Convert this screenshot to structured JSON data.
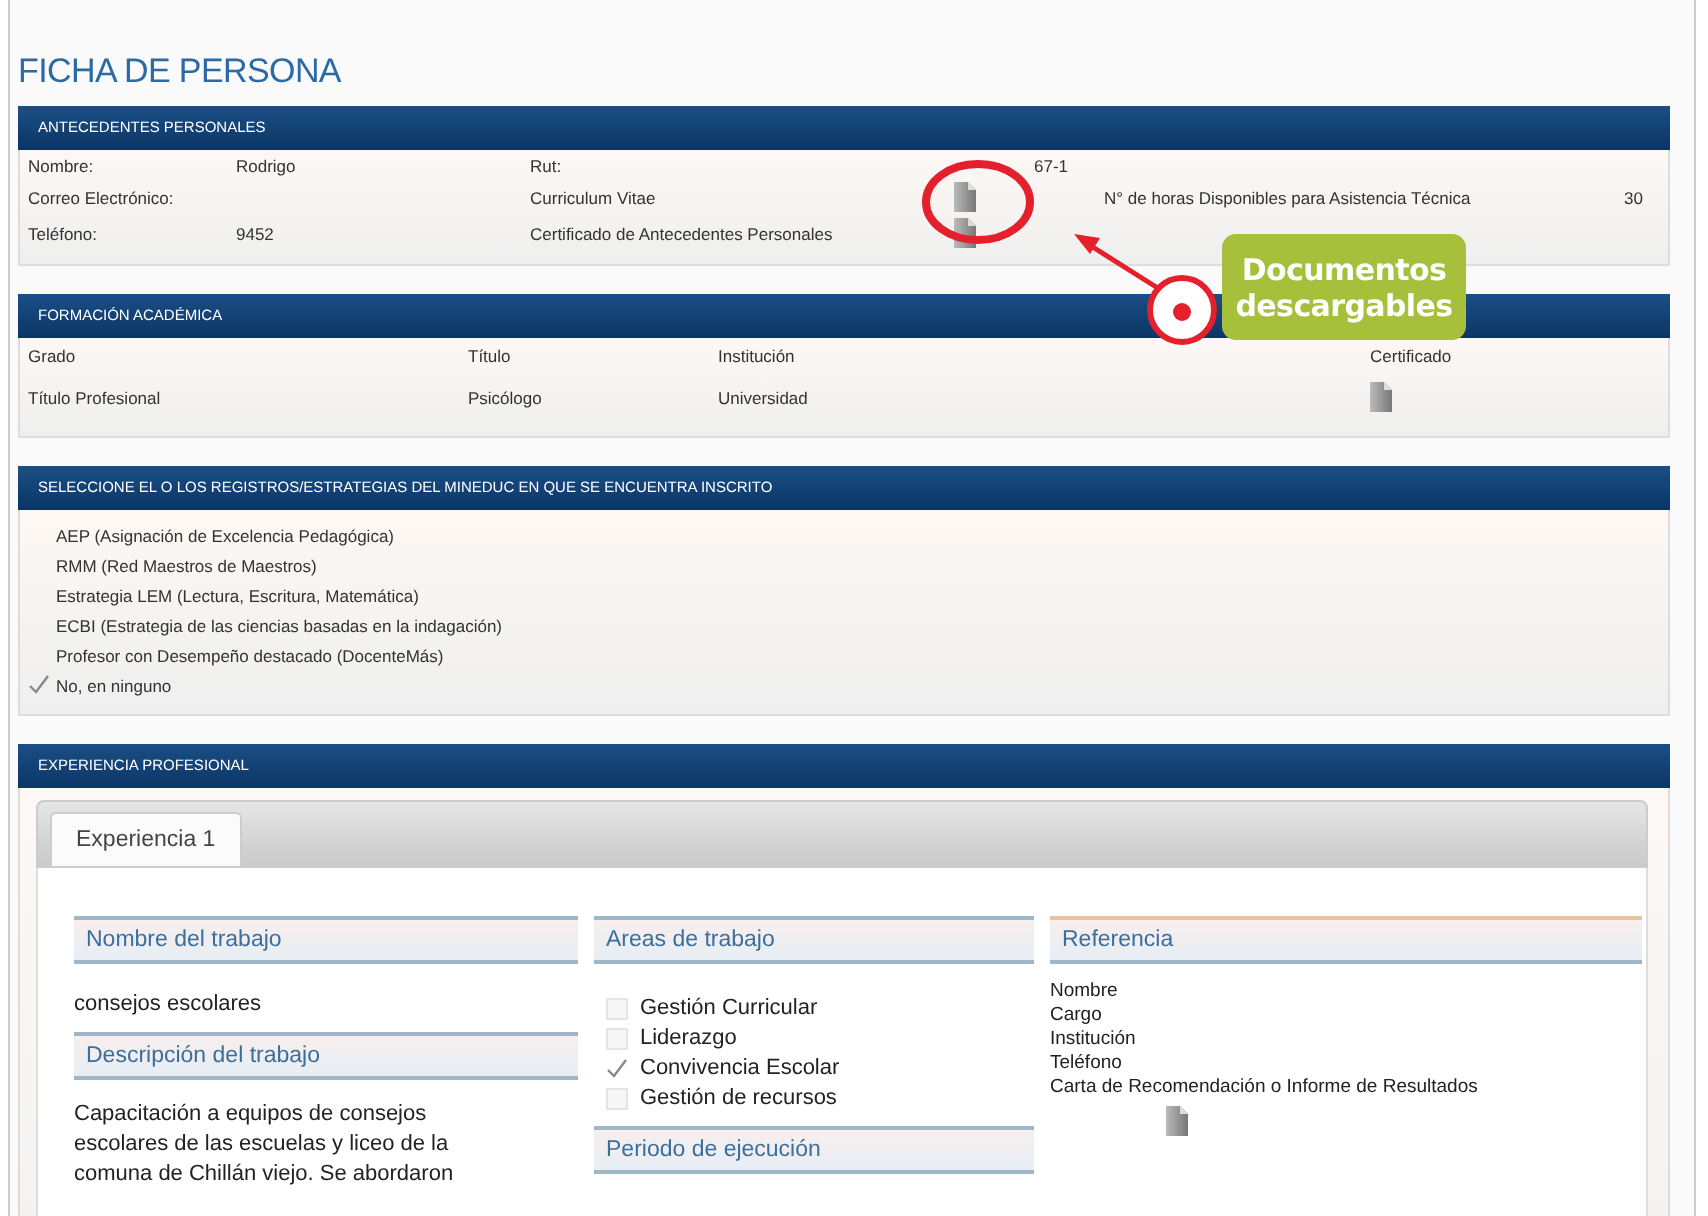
{
  "title": "FICHA DE PERSONA",
  "personal": {
    "heading": "ANTECEDENTES PERSONALES",
    "rows": [
      [
        {
          "kind": "label",
          "text": "Nombre:"
        },
        {
          "kind": "value",
          "text": "Rodrigo"
        },
        {
          "kind": "label",
          "text": "Rut:"
        },
        {
          "kind": "empty"
        },
        {
          "kind": "value",
          "text": "67-1"
        },
        {
          "kind": "empty"
        },
        {
          "kind": "empty"
        }
      ],
      [
        {
          "kind": "label",
          "text": "Correo Electrónico:"
        },
        {
          "kind": "empty"
        },
        {
          "kind": "label",
          "text": "Curriculum Vitae"
        },
        {
          "kind": "doc"
        },
        {
          "kind": "empty"
        },
        {
          "kind": "label",
          "text": "N° de horas Disponibles para Asistencia Técnica"
        },
        {
          "kind": "value",
          "text": "30"
        }
      ],
      [
        {
          "kind": "label",
          "text": "Teléfono:"
        },
        {
          "kind": "value",
          "text": "9452"
        },
        {
          "kind": "label",
          "text": "Certificado de Antecedentes Personales"
        },
        {
          "kind": "doc"
        }
      ]
    ]
  },
  "education": {
    "heading": "FORMACIÓN ACADÉMICA",
    "columns": [
      "Grado",
      "Título",
      "Institución",
      "Certificado"
    ],
    "rows": [
      [
        {
          "kind": "value",
          "text": "Título Profesional"
        },
        {
          "kind": "value",
          "text": "Psicólogo"
        },
        {
          "kind": "value",
          "text": "Universidad"
        },
        {
          "kind": "doc"
        }
      ]
    ]
  },
  "registries": {
    "heading": "SELECCIONE EL O LOS REGISTROS/ESTRATEGIAS DEL MINEDUC EN QUE SE ENCUENTRA INSCRITO",
    "items": [
      {
        "label": "AEP (Asignación de Excelencia Pedagógica)",
        "checked": false
      },
      {
        "label": "RMM (Red Maestros de Maestros)",
        "checked": false
      },
      {
        "label": "Estrategia LEM (Lectura, Escritura, Matemática)",
        "checked": false
      },
      {
        "label": "ECBI (Estrategia de las ciencias basadas en la indagación)",
        "checked": false
      },
      {
        "label": "Profesor con Desempeño destacado (DocenteMás)",
        "checked": false
      },
      {
        "label": "No, en ninguno",
        "checked": true
      }
    ]
  },
  "experience": {
    "heading": "EXPERIENCIA PROFESIONAL",
    "tabs": [
      {
        "label": "Experiencia 1",
        "selected": true
      }
    ],
    "job_name": {
      "heading": "Nombre del trabajo",
      "text": "consejos escolares"
    },
    "description": {
      "heading": "Descripción del trabajo",
      "text": "Capacitación a equipos de consejos escolares de las escuelas y liceo de la comuna de Chillán viejo. Se abordaron"
    },
    "areas": {
      "heading": "Areas de trabajo",
      "items": [
        {
          "label": "Gestión Curricular",
          "checked": false
        },
        {
          "label": "Liderazgo",
          "checked": false
        },
        {
          "label": "Convivencia Escolar",
          "checked": true
        },
        {
          "label": "Gestión de recursos",
          "checked": false
        }
      ]
    },
    "period": {
      "heading": "Periodo de ejecución"
    },
    "reference": {
      "heading": "Referencia",
      "lines": [
        "Nombre",
        "Cargo",
        "Institución",
        "Teléfono",
        "Carta de Recomendación o Informe de Resultados"
      ],
      "document": true
    }
  },
  "annotation": {
    "label": "Documentos descargables"
  }
}
